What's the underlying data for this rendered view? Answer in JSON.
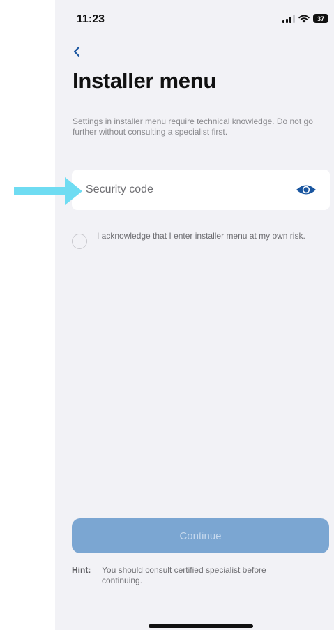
{
  "status_bar": {
    "time": "11:23",
    "battery": "37",
    "icons": [
      "signal-icon",
      "wifi-icon",
      "battery-icon"
    ]
  },
  "nav": {
    "back_icon": "chevron-left-icon"
  },
  "page": {
    "title": "Installer menu",
    "description": "Settings in installer menu require technical knowledge. Do not go further without consulting a specialist first."
  },
  "security_field": {
    "placeholder": "Security code",
    "value": "",
    "toggle_icon": "eye-icon"
  },
  "acknowledge": {
    "checked": false,
    "label": "I acknowledge that I enter installer menu at my own risk."
  },
  "continue_button": {
    "label": "Continue",
    "enabled": false
  },
  "hint": {
    "label": "Hint:",
    "text": "You should consult certified specialist before continuing."
  },
  "colors": {
    "accent": "#1a56a0",
    "button_disabled_bg": "#7ba6d2",
    "button_disabled_text": "#c6d9ee",
    "annotation_arrow": "#6fdcf2",
    "screen_bg": "#f2f2f6"
  }
}
